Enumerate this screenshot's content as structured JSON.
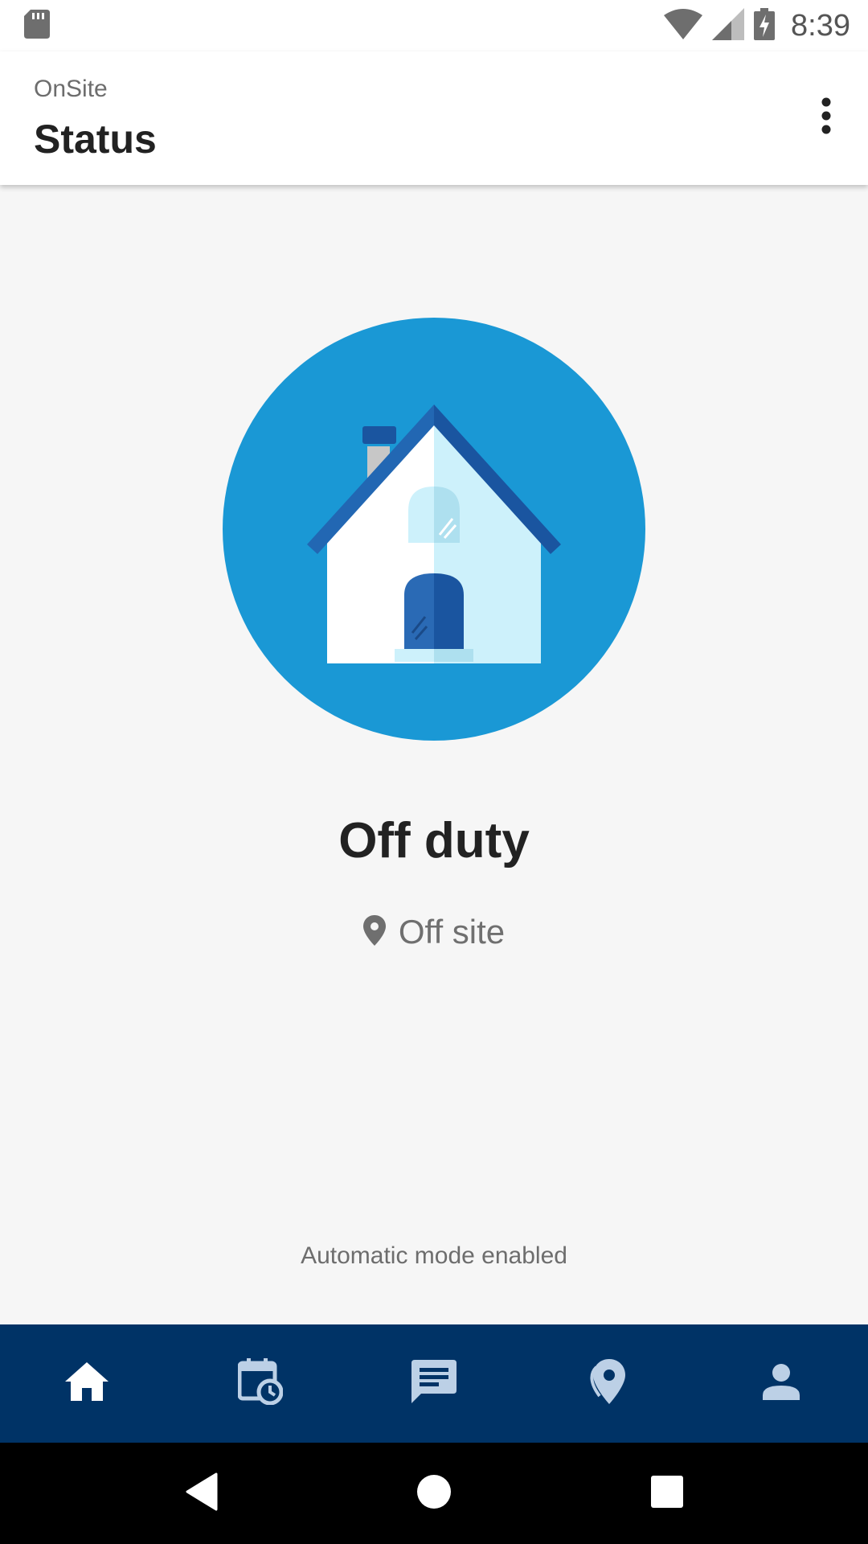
{
  "status_bar": {
    "time": "8:39",
    "icons": [
      "sd-card-icon",
      "wifi-icon",
      "signal-icon",
      "battery-charging-icon"
    ]
  },
  "app_bar": {
    "subtitle": "OnSite",
    "title": "Status",
    "overflow_icon": "more-vert-icon"
  },
  "main": {
    "illustration": "house-icon",
    "status": "Off duty",
    "location_icon": "location-pin-icon",
    "location": "Off site",
    "mode": "Automatic mode enabled"
  },
  "bottom_nav": {
    "items": [
      {
        "icon": "home-icon",
        "active": true
      },
      {
        "icon": "calendar-clock-icon",
        "active": false
      },
      {
        "icon": "message-icon",
        "active": false
      },
      {
        "icon": "map-pin-icon",
        "active": false
      },
      {
        "icon": "person-icon",
        "active": false
      }
    ]
  },
  "system_nav": [
    "back-icon",
    "home-circle-icon",
    "recents-icon"
  ],
  "colors": {
    "nav_background": "#003366",
    "circle": "#1a98d5",
    "roof": "#2267b3",
    "door": "#1a55a0",
    "house_light": "#cdf1fb"
  }
}
